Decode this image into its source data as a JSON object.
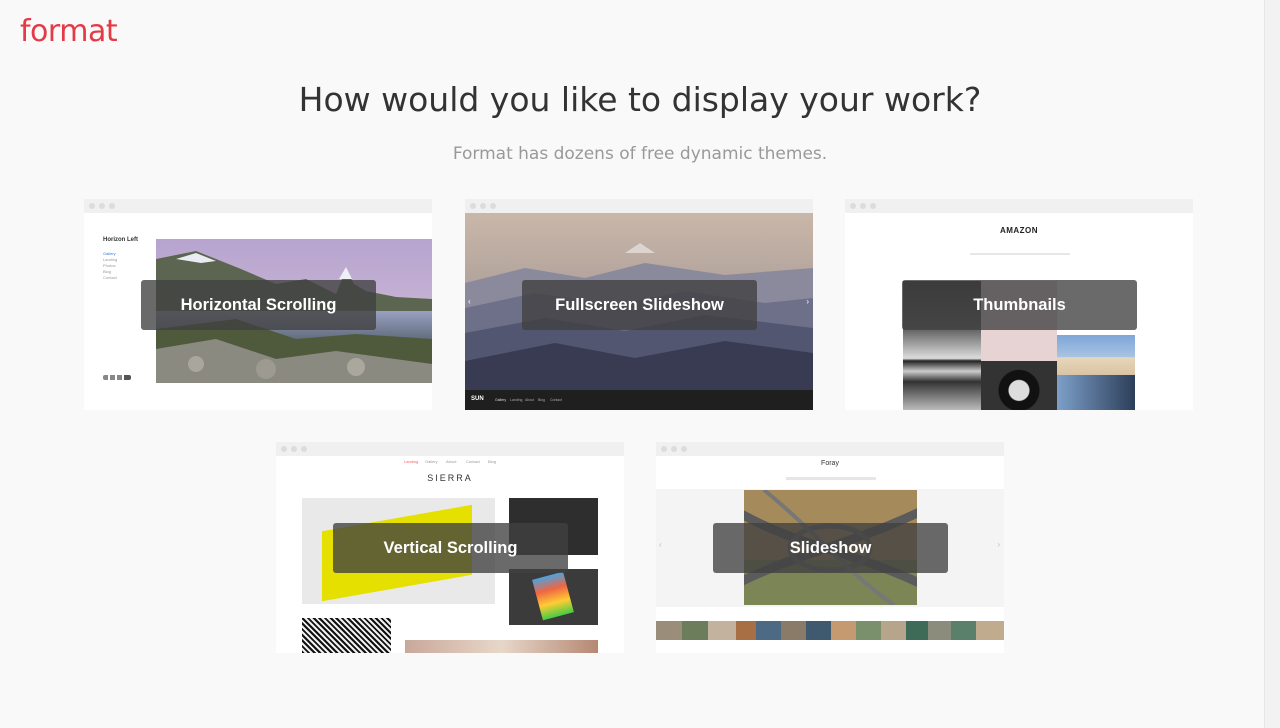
{
  "brand": {
    "logo": "format",
    "color": "#e63946"
  },
  "header": {
    "title": "How would you like to display your work?",
    "subtitle": "Format has dozens of free dynamic themes."
  },
  "themes": [
    {
      "label": "Horizontal Scrolling",
      "preview": {
        "site_title": "Horizon Left",
        "nav": [
          "Gallery",
          "Landing",
          "Photos",
          "Blog",
          "Contact"
        ]
      }
    },
    {
      "label": "Fullscreen Slideshow",
      "preview": {
        "site_title": "SUN",
        "nav": [
          "Gallery",
          "Landing",
          "About",
          "Blog",
          "Contact"
        ]
      }
    },
    {
      "label": "Thumbnails",
      "preview": {
        "site_title": "AMAZON"
      }
    },
    {
      "label": "Vertical Scrolling",
      "preview": {
        "site_title": "SIERRA",
        "nav": [
          "Landing",
          "Gallery",
          "About",
          "Contact",
          "Blog"
        ]
      }
    },
    {
      "label": "Slideshow",
      "preview": {
        "site_title": "Foray"
      }
    }
  ]
}
